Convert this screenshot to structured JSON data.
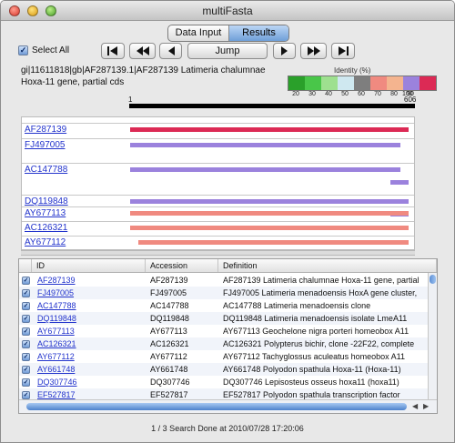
{
  "window": {
    "title": "multiFasta"
  },
  "tabs": [
    {
      "label": "Data Input",
      "selected": false
    },
    {
      "label": "Results",
      "selected": true
    }
  ],
  "toolbar": {
    "select_all_label": "Select All",
    "select_all_checked": true,
    "jump_label": "Jump"
  },
  "sequence": {
    "line1": "gi|11611818|gb|AF287139.1|AF287139 Latimeria chalumnae",
    "line2": "Hoxa-11 gene, partial cds"
  },
  "legend": {
    "title": "Identity (%)",
    "swatches": [
      {
        "label": "20",
        "color": "#2aa02a"
      },
      {
        "label": "30",
        "color": "#49c649"
      },
      {
        "label": "40",
        "color": "#9ee08f"
      },
      {
        "label": "50",
        "color": "#cfe8f0"
      },
      {
        "label": "60",
        "color": "#7e7e7e"
      },
      {
        "label": "70",
        "color": "#f08a80"
      },
      {
        "label": "80",
        "color": "#f4b48f"
      },
      {
        "label": "90",
        "color": "#9b82dd"
      },
      {
        "label": "100",
        "color": "#dc2a55"
      }
    ]
  },
  "ruler": {
    "start": "1",
    "end": "606"
  },
  "alignment": {
    "rows": [
      {
        "label": "AF287139",
        "color": "#dc2a55",
        "bars": [
          [
            0.0,
            1.0
          ]
        ]
      },
      {
        "label": "FJ497005",
        "color": "#9b82dd",
        "bars": [
          [
            0.0,
            0.97
          ]
        ]
      },
      {
        "label": "AC147788",
        "color": "#9b82dd",
        "bars": [
          [
            0.0,
            0.97
          ],
          [
            0.935,
            1.0
          ]
        ]
      },
      {
        "label": "DQ119848",
        "color": "#9b82dd",
        "bars": [
          [
            0.0,
            1.0
          ],
          [
            0.935,
            1.0
          ]
        ]
      },
      {
        "label": "AY677113",
        "color": "#f08a80",
        "bars": [
          [
            0.0,
            1.0
          ]
        ]
      },
      {
        "label": "AC126321",
        "color": "#f08a80",
        "bars": [
          [
            0.0,
            1.0
          ]
        ]
      },
      {
        "label": "AY677112",
        "color": "#f08a80",
        "bars": [
          [
            0.03,
            1.0
          ],
          [
            0.03,
            1.0
          ]
        ]
      },
      {
        "label": "AY677112",
        "color": "#f08a80",
        "bars": [
          [
            0.03,
            1.0
          ]
        ]
      }
    ]
  },
  "table": {
    "columns": [
      "ID",
      "Accession",
      "Definition"
    ],
    "rows": [
      {
        "id": "AF287139",
        "accession": "AF287139",
        "definition": "AF287139 Latimeria chalumnae Hoxa-11 gene, partial",
        "checked": true
      },
      {
        "id": "FJ497005",
        "accession": "FJ497005",
        "definition": "FJ497005 Latimeria menadoensis HoxA gene cluster,",
        "checked": true
      },
      {
        "id": "AC147788",
        "accession": "AC147788",
        "definition": "AC147788 Latimeria menadoensis clone",
        "checked": true
      },
      {
        "id": "DQ119848",
        "accession": "DQ119848",
        "definition": "DQ119848 Latimeria menadoensis isolate LmeA11",
        "checked": true
      },
      {
        "id": "AY677113",
        "accession": "AY677113",
        "definition": "AY677113 Geochelone nigra porteri homeobox A11",
        "checked": true
      },
      {
        "id": "AC126321",
        "accession": "AC126321",
        "definition": "AC126321 Polypterus bichir, clone -22F22, complete",
        "checked": true
      },
      {
        "id": "AY677112",
        "accession": "AY677112",
        "definition": "AY677112 Tachyglossus aculeatus homeobox A11",
        "checked": true
      },
      {
        "id": "AY661748",
        "accession": "AY661748",
        "definition": "AY661748 Polyodon spathula Hoxa-11 (Hoxa-11)",
        "checked": true
      },
      {
        "id": "DQ307746",
        "accession": "DQ307746",
        "definition": "DQ307746 Lepisosteus osseus hoxa11 (hoxa11)",
        "checked": true
      },
      {
        "id": "EF527817",
        "accession": "EF527817",
        "definition": "EF527817 Polyodon spathula transcription factor",
        "checked": true
      }
    ]
  },
  "status": "1 / 3   Search Done at 2010/07/28 17:20:06"
}
